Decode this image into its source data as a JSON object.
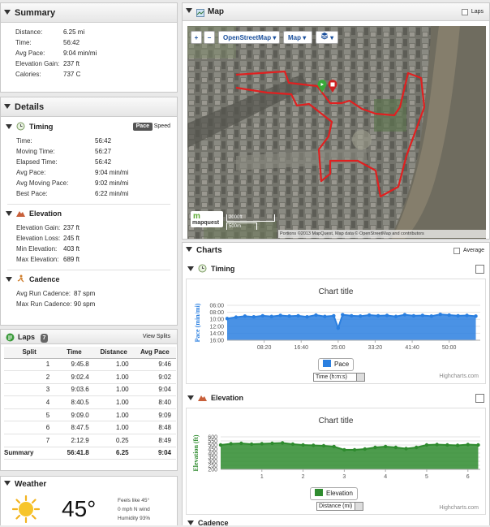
{
  "summary": {
    "title": "Summary",
    "rows": [
      {
        "label": "Distance:",
        "value": "6.25 mi"
      },
      {
        "label": "Time:",
        "value": "56:42"
      },
      {
        "label": "Avg Pace:",
        "value": "9:04 min/mi"
      },
      {
        "label": "Elevation Gain:",
        "value": "237 ft"
      },
      {
        "label": "Calories:",
        "value": "737 C"
      }
    ]
  },
  "details": {
    "title": "Details",
    "timing": {
      "title": "Timing",
      "toggle_active": "Pace",
      "toggle_other": "Speed",
      "rows": [
        {
          "label": "Time:",
          "value": "56:42"
        },
        {
          "label": "Moving Time:",
          "value": "56:27"
        },
        {
          "label": "Elapsed Time:",
          "value": "56:42"
        },
        {
          "label": "Avg Pace:",
          "value": "9:04 min/mi"
        },
        {
          "label": "Avg Moving Pace:",
          "value": "9:02 min/mi"
        },
        {
          "label": "Best Pace:",
          "value": "6:22 min/mi"
        }
      ]
    },
    "elevation": {
      "title": "Elevation",
      "rows": [
        {
          "label": "Elevation Gain:",
          "value": "237 ft"
        },
        {
          "label": "Elevation Loss:",
          "value": "245 ft"
        },
        {
          "label": "Min Elevation:",
          "value": "403 ft"
        },
        {
          "label": "Max Elevation:",
          "value": "689 ft"
        }
      ]
    },
    "cadence": {
      "title": "Cadence",
      "rows": [
        {
          "label": "Avg Run Cadence:",
          "value": "87 spm"
        },
        {
          "label": "Max Run Cadence:",
          "value": "90 spm"
        }
      ]
    }
  },
  "laps": {
    "title": "Laps",
    "count": "7",
    "view_splits": "View Splits",
    "columns": [
      "Split",
      "Time",
      "Distance",
      "Avg Pace"
    ],
    "rows": [
      [
        "1",
        "9:45.8",
        "1.00",
        "9:46"
      ],
      [
        "2",
        "9:02.4",
        "1.00",
        "9:02"
      ],
      [
        "3",
        "9:03.6",
        "1.00",
        "9:04"
      ],
      [
        "4",
        "8:40.5",
        "1.00",
        "8:40"
      ],
      [
        "5",
        "9:09.0",
        "1.00",
        "9:09"
      ],
      [
        "6",
        "8:47.5",
        "1.00",
        "8:48"
      ],
      [
        "7",
        "2:12.9",
        "0.25",
        "8:49"
      ]
    ],
    "summary": [
      "Summary",
      "56:41.8",
      "6.25",
      "9:04"
    ]
  },
  "weather": {
    "title": "Weather",
    "temperature": "45°",
    "feels_like": "Feels like 45°",
    "wind": "0 mph N wind",
    "humidity": "Humidity 93%"
  },
  "map": {
    "title": "Map",
    "laps_label": "Laps",
    "zoom_in": "+",
    "zoom_out": "−",
    "source_select": "OpenStreetMap",
    "type_select": "Map",
    "scale_ft": "2000ft",
    "scale_m": "500m",
    "logo": "mapquest",
    "attribution": "Portions ©2013 MapQuest, Map data © OpenStreetMap and contributors"
  },
  "charts": {
    "title": "Charts",
    "average_label": "Average",
    "timing": {
      "title": "Timing",
      "chart_title": "Chart title",
      "select": "Time (h:m:s)",
      "legend": "Pace",
      "credit": "Highcharts.com"
    },
    "elevation": {
      "title": "Elevation",
      "chart_title": "Chart title",
      "select": "Distance (mi)",
      "legend": "Elevation",
      "credit": "Highcharts.com"
    },
    "next_title": "Cadence"
  },
  "colors": {
    "pace": "#2a7fe0",
    "elevation": "#2e8b2e",
    "route": "#e02020"
  },
  "chart_data": [
    {
      "type": "area",
      "title": "Chart title",
      "xlabel": "",
      "ylabel": "Pace (min/mi)",
      "x_ticks": [
        "08:20",
        "16:40",
        "25:00",
        "33:20",
        "41:40",
        "50:00"
      ],
      "y_ticks": [
        "06:00",
        "08:00",
        "10:00",
        "12:00",
        "14:00",
        "16:00"
      ],
      "y_reversed": true,
      "series": [
        {
          "name": "Pace",
          "x": [
            0,
            2,
            4,
            6,
            8,
            10,
            12,
            14,
            16,
            18,
            20,
            22,
            24,
            25,
            26,
            28,
            30,
            32,
            34,
            36,
            38,
            40,
            42,
            44,
            46,
            48,
            50,
            52,
            54,
            56
          ],
          "values": [
            9.8,
            9.4,
            9.1,
            9.3,
            9.0,
            9.2,
            8.9,
            9.1,
            9.0,
            9.3,
            8.8,
            9.2,
            9.0,
            12.5,
            8.7,
            9.0,
            9.1,
            8.8,
            9.0,
            8.9,
            9.2,
            8.7,
            9.0,
            8.9,
            9.1,
            8.6,
            8.8,
            9.0,
            8.9,
            9.1
          ]
        }
      ]
    },
    {
      "type": "area",
      "title": "Chart title",
      "xlabel": "",
      "ylabel": "Elevation (ft)",
      "x_ticks": [
        "1",
        "2",
        "3",
        "4",
        "5",
        "6"
      ],
      "y_ticks": [
        "200",
        "250",
        "300",
        "350",
        "400",
        "450",
        "500",
        "550",
        "600"
      ],
      "ylim": [
        200,
        600
      ],
      "series": [
        {
          "name": "Elevation",
          "x": [
            0,
            0.25,
            0.5,
            0.75,
            1.0,
            1.25,
            1.5,
            1.75,
            2.0,
            2.25,
            2.5,
            2.75,
            3.0,
            3.25,
            3.5,
            3.75,
            4.0,
            4.25,
            4.5,
            4.75,
            5.0,
            5.25,
            5.5,
            5.75,
            6.0,
            6.25
          ],
          "values": [
            500,
            515,
            520,
            510,
            515,
            520,
            525,
            510,
            500,
            495,
            490,
            480,
            440,
            440,
            450,
            470,
            480,
            470,
            455,
            470,
            500,
            505,
            500,
            495,
            505,
            500
          ]
        }
      ]
    }
  ]
}
